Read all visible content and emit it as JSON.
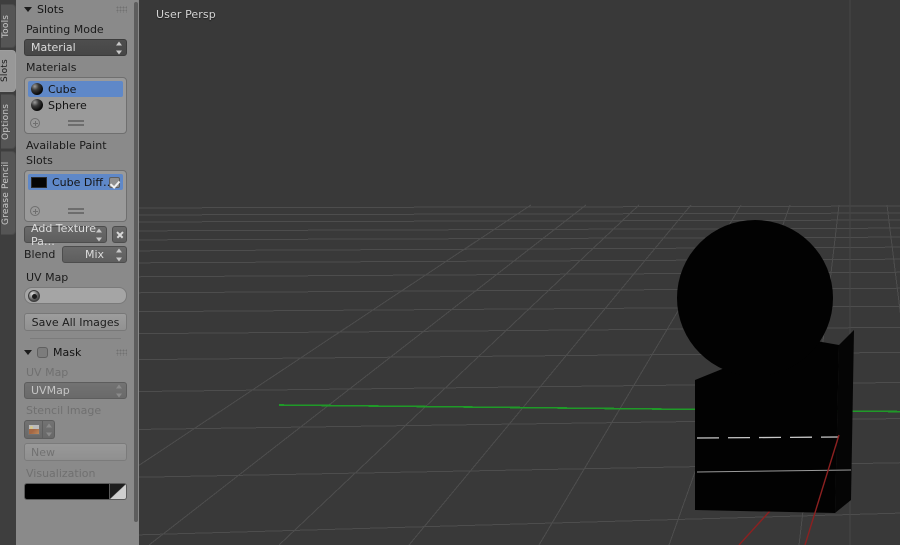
{
  "viewport": {
    "perspective_label": "User Persp",
    "background_color": "#393939",
    "grid_color": "#4f4f4f",
    "axis_y_color": "#1f9a28",
    "axis_x_color": "#8c2020",
    "object_color": "#020202",
    "objects": [
      {
        "name": "Cube",
        "shape": "cube"
      },
      {
        "name": "Sphere",
        "shape": "sphere"
      }
    ]
  },
  "tabstrip": {
    "tabs": [
      {
        "label": "Tools",
        "active": false
      },
      {
        "label": "Slots",
        "active": true
      },
      {
        "label": "Options",
        "active": false
      },
      {
        "label": "Grease Pencil",
        "active": false
      }
    ]
  },
  "slots_panel": {
    "title": "Slots",
    "expanded": true,
    "painting_mode": {
      "label": "Painting Mode",
      "value": "Material"
    },
    "materials": {
      "label": "Materials",
      "items": [
        {
          "name": "Cube",
          "selected": true
        },
        {
          "name": "Sphere",
          "selected": false
        }
      ]
    },
    "available_paint_slots": {
      "label": "Available Paint Slots",
      "items": [
        {
          "name": "Cube Diff…",
          "selected": true,
          "enabled": true
        }
      ]
    },
    "add_texture_slot": {
      "label": "Add Texture Pa…"
    },
    "blend": {
      "label": "Blend",
      "value": "Mix"
    },
    "uv_map": {
      "label": "UV Map",
      "value": ""
    },
    "save_all_images": {
      "label": "Save All Images"
    }
  },
  "mask_panel": {
    "title": "Mask",
    "expanded": true,
    "enabled": false,
    "uv_map": {
      "label": "UV Map",
      "value": "UVMap"
    },
    "stencil_image": {
      "label": "Stencil Image",
      "new_button": "New"
    },
    "visualization": {
      "label": "Visualization",
      "color": "#000000"
    }
  }
}
